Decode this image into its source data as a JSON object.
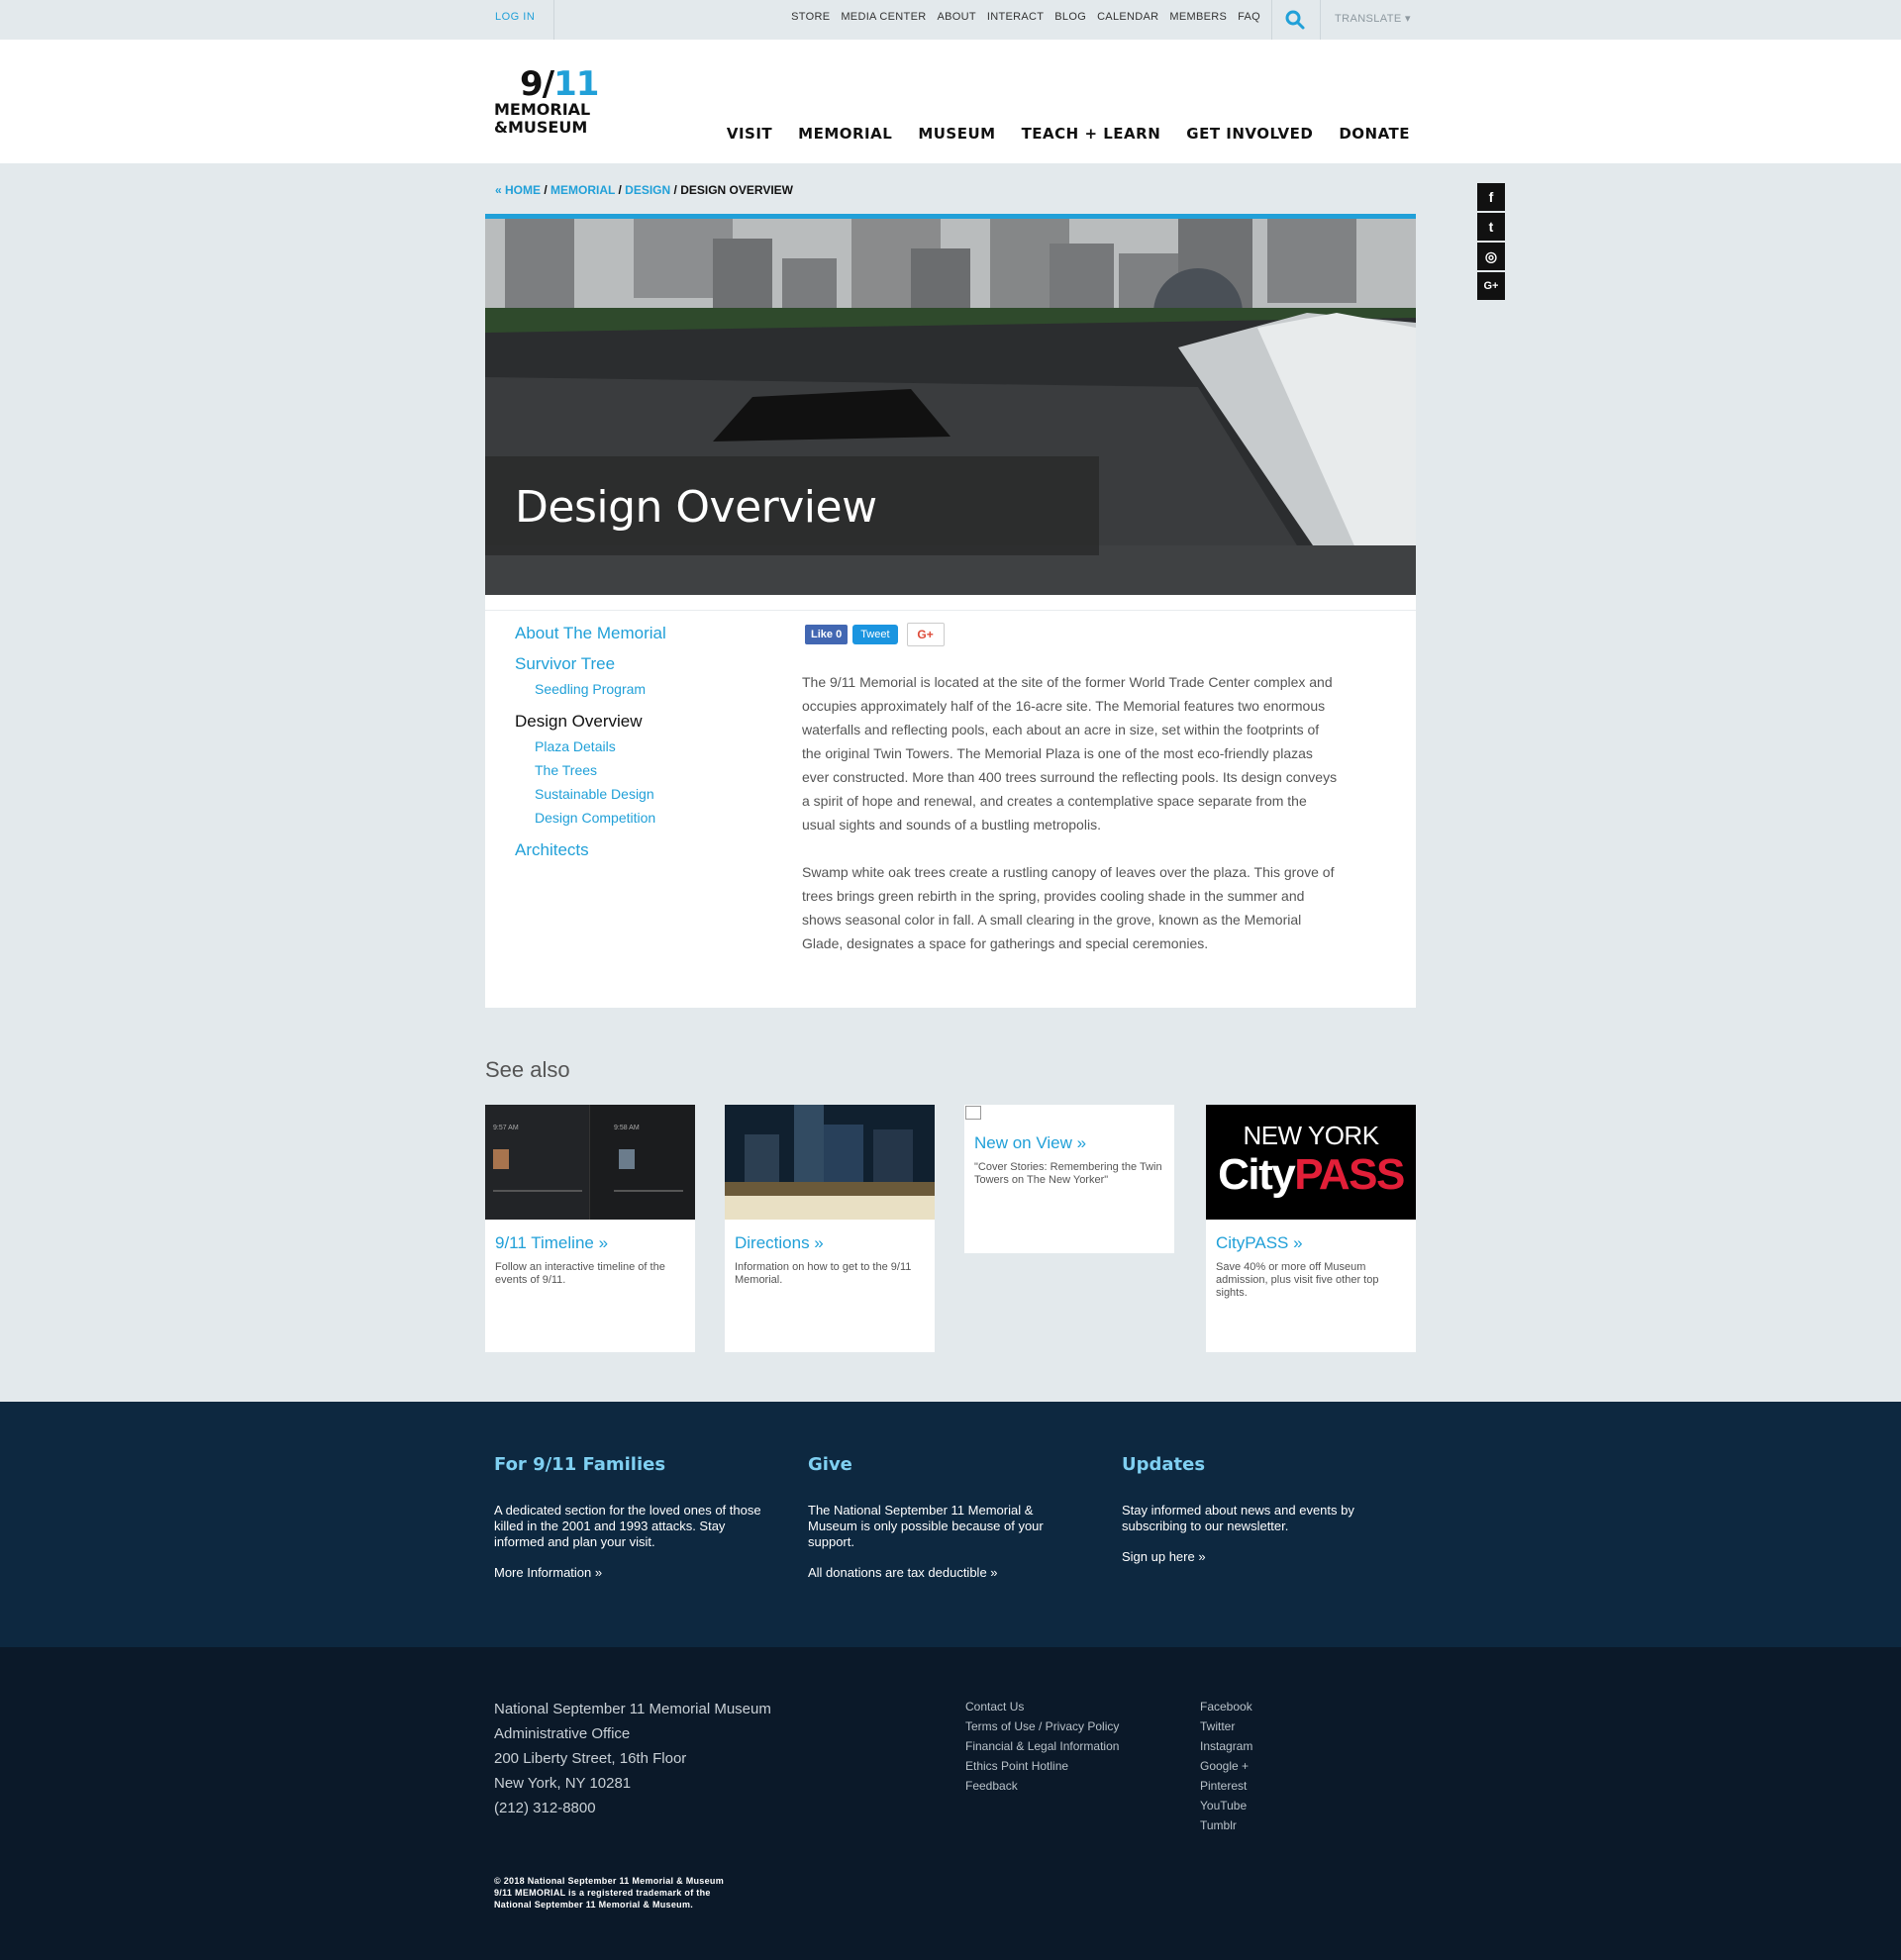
{
  "utility": {
    "login": "LOG IN",
    "links": [
      "STORE",
      "MEDIA CENTER",
      "ABOUT",
      "INTERACT",
      "BLOG",
      "CALENDAR",
      "MEMBERS",
      "FAQ"
    ],
    "translate": "TRANSLATE ▾"
  },
  "logo": {
    "line1a": "9/",
    "line1b": "11",
    "line2": "MEMORIAL",
    "line3": "&MUSEUM"
  },
  "nav": [
    "VISIT",
    "MEMORIAL",
    "MUSEUM",
    "TEACH + LEARN",
    "GET INVOLVED",
    "DONATE"
  ],
  "breadcrumb": {
    "home": "« HOME",
    "sep": " / ",
    "memorial": "MEMORIAL",
    "design": "DESIGN",
    "current": "DESIGN OVERVIEW"
  },
  "social_side": [
    "f",
    "t",
    "◎",
    "G+"
  ],
  "hero": {
    "title": "Design Overview"
  },
  "subnav": {
    "about": "About The Memorial",
    "survivor": "Survivor Tree",
    "seedling": "Seedling Program",
    "design_overview": "Design Overview",
    "plaza": "Plaza Details",
    "trees": "The Trees",
    "sustainable": "Sustainable Design",
    "competition": "Design Competition",
    "architects": "Architects"
  },
  "share": {
    "like": "Like 0",
    "tweet": "Tweet",
    "gplus": "G+"
  },
  "body": {
    "p1": "The 9/11 Memorial is located at the site of the former World Trade Center complex and occupies approximately half of the 16-acre site. The Memorial features two enormous waterfalls and reflecting pools, each about an acre in size, set within the footprints of the original Twin Towers. The Memorial Plaza is one of the most eco-friendly plazas ever constructed. More than 400 trees surround the reflecting pools. Its design conveys a spirit of hope and renewal, and creates a contemplative space separate from the usual sights and sounds of a bustling metropolis.",
    "p2": "Swamp white oak trees create a rustling canopy of leaves over the plaza. This grove of trees brings green rebirth in the spring, provides cooling shade in the summer and shows seasonal color in fall. A small clearing in the grove, known as the Memorial Glade, designates a space for gatherings and special ceremonies."
  },
  "see_also": {
    "title": "See also",
    "cards": [
      {
        "title": "9/11 Timeline »",
        "desc": "Follow an interactive timeline of the events of 9/11.",
        "thumb_t1": "9:57 AM",
        "thumb_t2": "9:58 AM"
      },
      {
        "title": "Directions »",
        "desc": "Information on how to get to the 9/11 Memorial."
      },
      {
        "title": "New on View »",
        "desc": "\"Cover Stories: Remembering the Twin Towers on The New Yorker\""
      },
      {
        "title": "CityPASS »",
        "desc": "Save 40% or more off Museum admission, plus visit five other top sights.",
        "thumb_l1": "NEW YORK",
        "thumb_l2a": "City",
        "thumb_l2b": "PASS"
      }
    ]
  },
  "footer_top": {
    "families": {
      "title": "For 9/11 Families",
      "desc": "A dedicated section for the loved ones of those killed in the 2001 and 1993 attacks. Stay informed and plan your visit.",
      "link": "More Information »"
    },
    "give": {
      "title": "Give",
      "desc": "The National September 11 Memorial & Museum is only possible because of your support.",
      "link": "All donations are tax deductible »"
    },
    "updates": {
      "title": "Updates",
      "desc": "Stay informed about news and events by subscribing to our newsletter.",
      "link": "Sign up here »"
    }
  },
  "footer_bottom": {
    "address": [
      "National September 11 Memorial Museum",
      "Administrative Office",
      "200 Liberty Street, 16th Floor",
      "New York, NY 10281",
      "(212) 312-8800"
    ],
    "links1": [
      "Contact Us",
      "Terms of Use / Privacy Policy",
      "Financial & Legal Information",
      "Ethics Point Hotline",
      "Feedback"
    ],
    "links2": [
      "Facebook",
      "Twitter",
      "Instagram",
      "Google +",
      "Pinterest",
      "YouTube",
      "Tumblr"
    ],
    "copy1": "© 2018 National September 11 Memorial & Museum",
    "copy2": "9/11 MEMORIAL is a registered trademark of the",
    "copy3": "National September 11 Memorial & Museum."
  },
  "colors": {
    "accent": "#21a0d8",
    "footer_top": "#0d2840",
    "footer_bottom": "#0b1929"
  }
}
